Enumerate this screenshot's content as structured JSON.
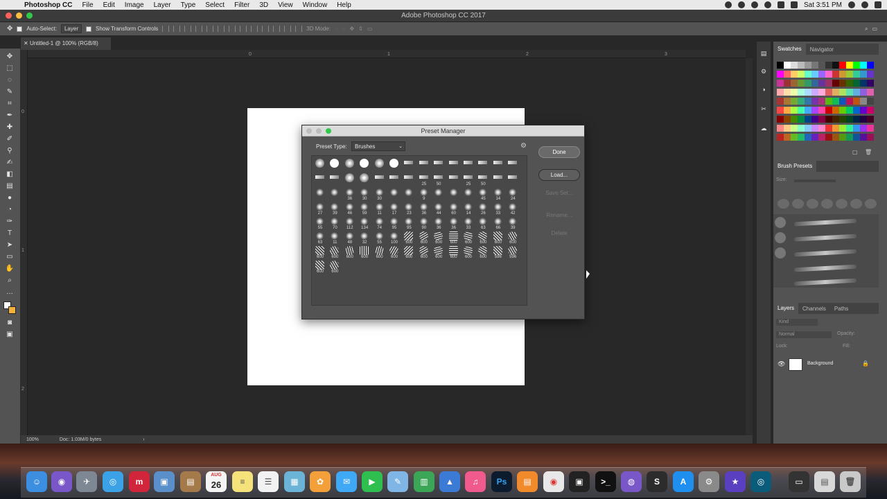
{
  "menubar": {
    "apple": "",
    "app_name": "Photoshop CC",
    "menus": [
      "File",
      "Edit",
      "Image",
      "Layer",
      "Type",
      "Select",
      "Filter",
      "3D",
      "View",
      "Window",
      "Help"
    ],
    "clock": "Sat 3:51 PM"
  },
  "window": {
    "title": "Adobe Photoshop CC 2017"
  },
  "options_bar": {
    "auto_select_label": "Auto-Select:",
    "auto_select_value": "Layer",
    "transform_label": "Show Transform Controls",
    "mode_3d_label": "3D Mode:"
  },
  "document": {
    "tab_label": "Untitled-1 @ 100% (RGB/8)"
  },
  "rulers": {
    "top_ticks": [
      "0",
      "1",
      "2",
      "3"
    ],
    "left_ticks": [
      "0",
      "1",
      "2"
    ]
  },
  "status": {
    "zoom": "100%",
    "doc_info": "Doc: 1.03M/0 bytes"
  },
  "panels": {
    "swatches_tabs": [
      "Swatches",
      "Navigator"
    ],
    "brush_presets_title": "Brush Presets",
    "size_label": "Size:",
    "layers_tabs": [
      "Layers",
      "Channels",
      "Paths"
    ],
    "kind_label": "Kind",
    "blend_mode": "Normal",
    "opacity_label": "Opacity:",
    "lock_label": "Lock:",
    "fill_label": "Fill:",
    "layer_name": "Background"
  },
  "dialog": {
    "title": "Preset Manager",
    "preset_type_label": "Preset Type:",
    "preset_type_value": "Brushes",
    "buttons": {
      "done": "Done",
      "load": "Load...",
      "save": "Save Set...",
      "rename": "Rename...",
      "delete": "Delete"
    },
    "brush_rows": [
      [
        "",
        "",
        "",
        "",
        "",
        "",
        "",
        "",
        "",
        "",
        "",
        "",
        "",
        ""
      ],
      [
        "",
        "",
        "",
        "",
        "",
        "",
        "",
        "25",
        "50",
        "",
        "25",
        "50",
        "",
        ""
      ],
      [
        "",
        "",
        "36",
        "30",
        "30",
        "",
        "",
        "9",
        "",
        "",
        "",
        "45",
        "14",
        "24"
      ],
      [
        "27",
        "39",
        "46",
        "59",
        "11",
        "17",
        "23",
        "36",
        "44",
        "60",
        "14",
        "26",
        "33",
        "42"
      ],
      [
        "55",
        "70",
        "112",
        "134",
        "74",
        "95",
        "95",
        "90",
        "36",
        "36",
        "33",
        "63",
        "66",
        "39"
      ],
      [
        "63",
        "11",
        "48",
        "32",
        "55",
        "100",
        "600",
        "600",
        "600",
        "600",
        "600",
        "600",
        "600",
        "600"
      ],
      [
        "600",
        "600",
        "600",
        "600",
        "600",
        "600",
        "600",
        "600",
        "600",
        "600",
        "600",
        "600",
        "596",
        "596"
      ],
      [
        "600",
        "600"
      ]
    ]
  },
  "colors": {
    "accent_close": "#fc605b",
    "accent_min": "#fdbc40",
    "accent_max": "#34c84a"
  },
  "dock": {
    "calendar_month": "AUG",
    "calendar_day": "26"
  }
}
